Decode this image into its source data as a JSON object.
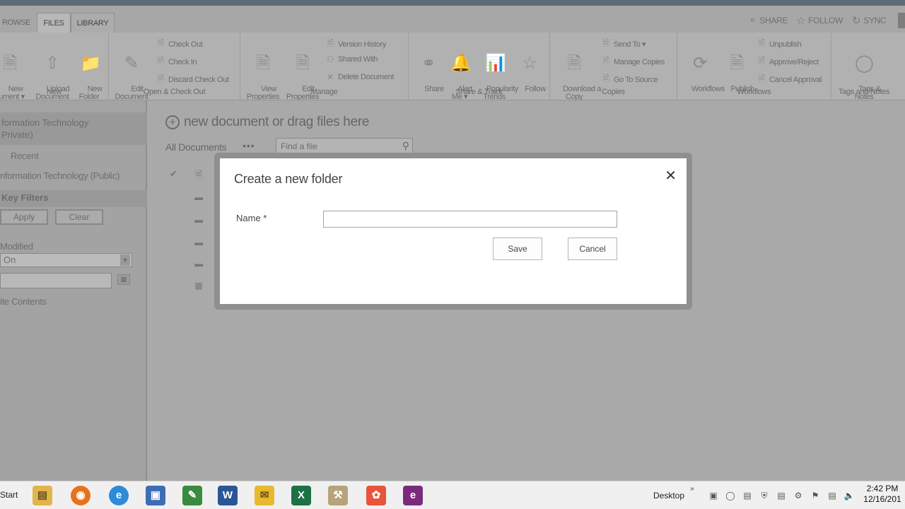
{
  "tabs": [
    {
      "label": "ROWSE",
      "active": false
    },
    {
      "label": "FILES",
      "active": true
    },
    {
      "label": "LIBRARY",
      "active": false
    }
  ],
  "topright": {
    "share": "SHARE",
    "follow": "FOLLOW",
    "sync": "SYNC"
  },
  "ribbon": {
    "new": {
      "label": "New",
      "new_document": "New\ncument ▾",
      "upload_document": "Upload\nDocument",
      "new_folder": "New\nFolder"
    },
    "open_checkout": {
      "label": "Open & Check Out",
      "edit_document": "Edit\nDocument",
      "check_out": "Check Out",
      "check_in": "Check In",
      "discard_check_out": "Discard Check Out"
    },
    "manage": {
      "label": "Manage",
      "view_properties": "View\nProperties",
      "edit_properties": "Edit\nProperties",
      "version_history": "Version History",
      "shared_with": "Shared With",
      "delete_document": "Delete Document"
    },
    "share_track": {
      "label": "Share & Track",
      "share": "Share",
      "alert_me": "Alert\nMe ▾",
      "popularity_trends": "Popularity\nTrends",
      "follow": "Follow"
    },
    "copies": {
      "label": "Copies",
      "download_copy": "Download a\nCopy",
      "send_to": "Send To ▾",
      "manage_copies": "Manage Copies",
      "go_to_source": "Go To Source"
    },
    "workflows": {
      "label": "Workflows",
      "workflows": "Workflows",
      "publish": "Publish",
      "unpublish": "Unpublish",
      "approve_reject": "Approve/Reject",
      "cancel_approval": "Cancel Approval"
    },
    "tags_notes": {
      "label": "Tags and Notes",
      "tags_notes": "Tags &\nNotes"
    }
  },
  "leftnav": {
    "site_title_line1": "formation Technology",
    "site_title_line2": "Private)",
    "recent": "Recent",
    "public_site": "nformation Technology (Public)",
    "key_filters": "Key Filters",
    "apply": "Apply",
    "clear": "Clear",
    "modified_label": "Modified",
    "modified_select": "On",
    "site_contents": "ite Contents"
  },
  "main": {
    "new_document_text": "new document or drag files here",
    "view_name": "All Documents",
    "view_more": "•••",
    "search_placeholder": "Find a file"
  },
  "dialog": {
    "title": "Create a new folder",
    "name_label": "Name *",
    "name_value": "",
    "save": "Save",
    "cancel": "Cancel",
    "close": "✕"
  },
  "taskbar": {
    "start": "Start",
    "desktop": "Desktop",
    "desktop_arrows": "»",
    "time": "2:42 PM",
    "date": "12/16/201"
  },
  "colors": {
    "dialog_bg": "#ffffff",
    "overlay_gray": "#a9a9a9",
    "taskbar_bg": "#f0f0f0"
  }
}
